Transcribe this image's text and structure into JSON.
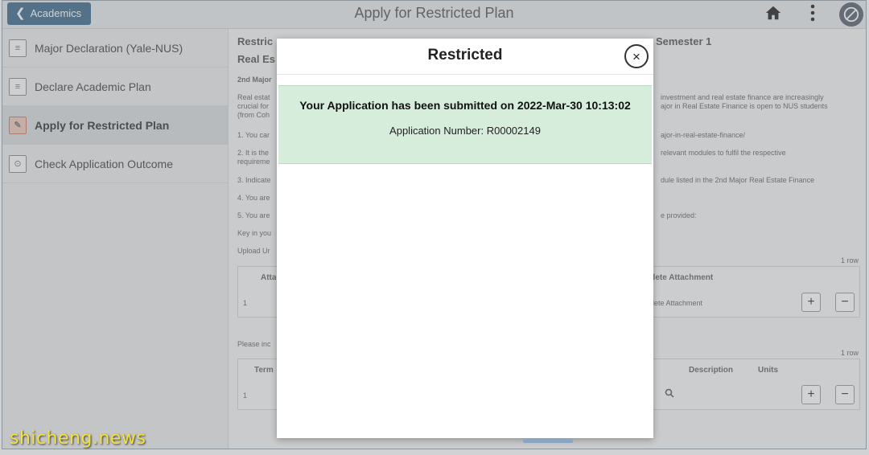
{
  "header": {
    "back_label": "Academics",
    "title": "Apply for Restricted Plan",
    "home_icon": "home-icon",
    "menu_icon": "kebab-menu-icon",
    "nav_icon": "navbar-icon"
  },
  "sidebar": {
    "items": [
      {
        "label": "Major Declaration (Yale-NUS)",
        "icon": "document-icon"
      },
      {
        "label": "Declare Academic Plan",
        "icon": "document-icon"
      },
      {
        "label": "Apply for Restricted Plan",
        "icon": "application-icon"
      },
      {
        "label": "Check Application Outcome",
        "icon": "search-document-icon"
      }
    ]
  },
  "background": {
    "heading": "Restric",
    "heading_right": "Semester 1",
    "sub_heading": "Real Es",
    "second_major": "2nd Major",
    "para_left_1": "Real estat",
    "para_left_2": "crucial for",
    "para_left_3": "(from Coh",
    "para_right_1": "investment and real estate finance are increasingly",
    "para_right_2": "ajor in Real Estate Finance is open to NUS students",
    "item1_left": "1. You car",
    "item1_right": "ajor-in-real-estate-finance/",
    "item2_left": "2. It is the",
    "item2_left_b": "requireme",
    "item2_right": "relevant modules to fulfil the respective",
    "item3_left": "3. Indicate",
    "item3_right": "dule listed in the 2nd Major Real Estate Finance",
    "item4_left": "4. You are",
    "item5_left": "5. You are",
    "item5_right": "e provided:",
    "key_in": "Key in you",
    "upload": "Upload Ur",
    "rows1": "1 row",
    "col_attach": "Atta",
    "col_delete": "elete Attachment",
    "row_num_1": "1",
    "delete_link": "elete Attachment",
    "please": "Please inc",
    "rows2": "1 row",
    "col_term": "Term",
    "col_desc": "Description",
    "col_units": "Units",
    "row_num_2": "1",
    "plus": "+",
    "minus": "−"
  },
  "modal": {
    "title": "Restricted",
    "close_label": "×",
    "message": "Your Application has been submitted on 2022-Mar-30 10:13:02",
    "application_number": "Application Number: R00002149"
  },
  "watermark": "shicheng.news"
}
